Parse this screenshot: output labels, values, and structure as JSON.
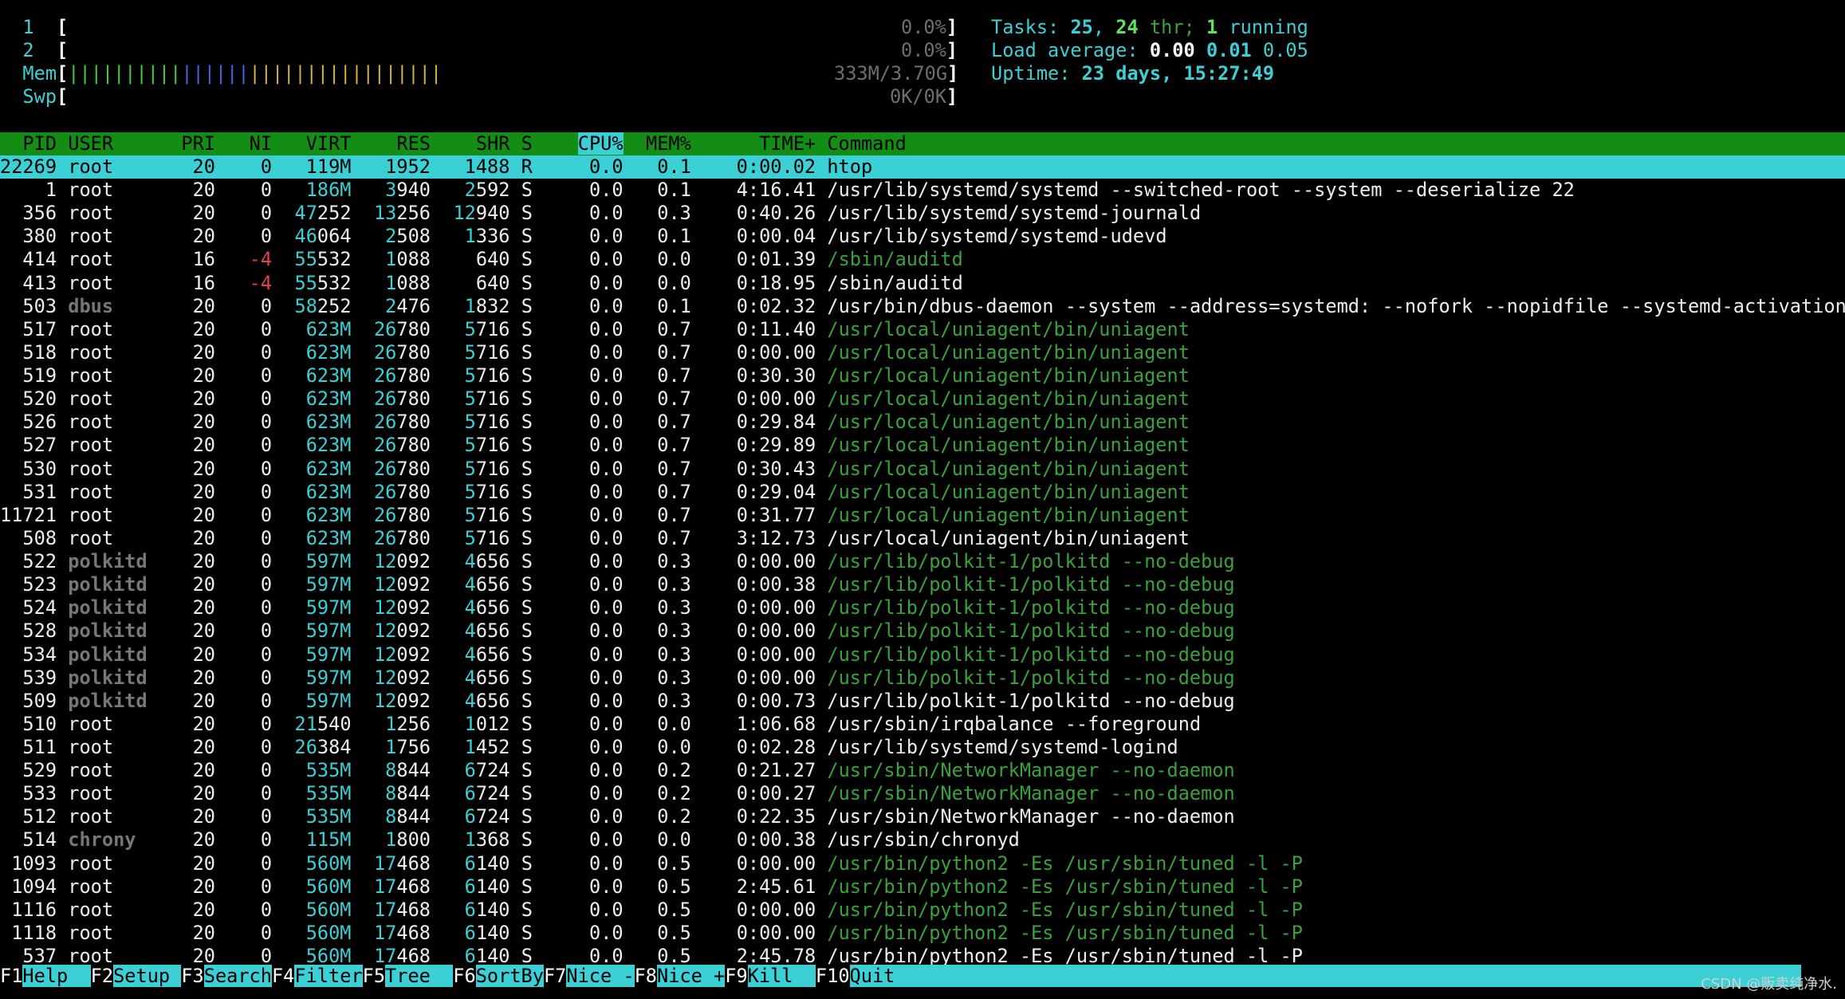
{
  "meters": {
    "cpu1": {
      "label": "1",
      "value": "0.0%"
    },
    "cpu2": {
      "label": "2",
      "value": "0.0%"
    },
    "mem": {
      "label": "Mem",
      "value": "333M/3.70G"
    },
    "swp": {
      "label": "Swp",
      "value": "0K/0K"
    }
  },
  "stats": {
    "tasks_label": "Tasks:",
    "tasks": "25",
    "threads": "24",
    "thr_label": "thr;",
    "running": "1",
    "running_label": "running",
    "load_label": "Load average:",
    "load1": "0.00",
    "load5": "0.01",
    "load15": "0.05",
    "uptime_label": "Uptime:",
    "uptime": "23 days, 15:27:49"
  },
  "columns": [
    "PID",
    "USER",
    "PRI",
    "NI",
    "VIRT",
    "RES",
    "SHR",
    "S",
    "CPU%",
    "MEM%",
    "TIME+",
    "Command"
  ],
  "sorted_column": "CPU%",
  "processes": [
    {
      "pid": "22269",
      "user": "root",
      "pri": "20",
      "ni": "0",
      "virt": "119M",
      "res": "1952",
      "shr": "1488",
      "s": "R",
      "cpu": "0.0",
      "mem": "0.1",
      "time": "0:00.02",
      "cmd": "htop",
      "selected": true
    },
    {
      "pid": "1",
      "user": "root",
      "pri": "20",
      "ni": "0",
      "virt": "186M",
      "res": "3940",
      "shr": "2592",
      "s": "S",
      "cpu": "0.0",
      "mem": "0.1",
      "time": "4:16.41",
      "cmd": "/usr/lib/systemd/systemd --switched-root --system --deserialize 22"
    },
    {
      "pid": "356",
      "user": "root",
      "pri": "20",
      "ni": "0",
      "virt": "47252",
      "res": "13256",
      "shr": "12940",
      "s": "S",
      "cpu": "0.0",
      "mem": "0.3",
      "time": "0:40.26",
      "cmd": "/usr/lib/systemd/systemd-journald"
    },
    {
      "pid": "380",
      "user": "root",
      "pri": "20",
      "ni": "0",
      "virt": "46064",
      "res": "2508",
      "shr": "1336",
      "s": "S",
      "cpu": "0.0",
      "mem": "0.1",
      "time": "0:00.04",
      "cmd": "/usr/lib/systemd/systemd-udevd"
    },
    {
      "pid": "414",
      "user": "root",
      "pri": "16",
      "ni": "-4",
      "virt": "55532",
      "res": "1088",
      "shr": "640",
      "s": "S",
      "cpu": "0.0",
      "mem": "0.0",
      "time": "0:01.39",
      "cmd": "/sbin/auditd",
      "thread": true
    },
    {
      "pid": "413",
      "user": "root",
      "pri": "16",
      "ni": "-4",
      "virt": "55532",
      "res": "1088",
      "shr": "640",
      "s": "S",
      "cpu": "0.0",
      "mem": "0.0",
      "time": "0:18.95",
      "cmd": "/sbin/auditd"
    },
    {
      "pid": "503",
      "user": "dbus",
      "pri": "20",
      "ni": "0",
      "virt": "58252",
      "res": "2476",
      "shr": "1832",
      "s": "S",
      "cpu": "0.0",
      "mem": "0.1",
      "time": "0:02.32",
      "cmd": "/usr/bin/dbus-daemon --system --address=systemd: --nofork --nopidfile --systemd-activation"
    },
    {
      "pid": "517",
      "user": "root",
      "pri": "20",
      "ni": "0",
      "virt": "623M",
      "res": "26780",
      "shr": "5716",
      "s": "S",
      "cpu": "0.0",
      "mem": "0.7",
      "time": "0:11.40",
      "cmd": "/usr/local/uniagent/bin/uniagent",
      "thread": true
    },
    {
      "pid": "518",
      "user": "root",
      "pri": "20",
      "ni": "0",
      "virt": "623M",
      "res": "26780",
      "shr": "5716",
      "s": "S",
      "cpu": "0.0",
      "mem": "0.7",
      "time": "0:00.00",
      "cmd": "/usr/local/uniagent/bin/uniagent",
      "thread": true
    },
    {
      "pid": "519",
      "user": "root",
      "pri": "20",
      "ni": "0",
      "virt": "623M",
      "res": "26780",
      "shr": "5716",
      "s": "S",
      "cpu": "0.0",
      "mem": "0.7",
      "time": "0:30.30",
      "cmd": "/usr/local/uniagent/bin/uniagent",
      "thread": true
    },
    {
      "pid": "520",
      "user": "root",
      "pri": "20",
      "ni": "0",
      "virt": "623M",
      "res": "26780",
      "shr": "5716",
      "s": "S",
      "cpu": "0.0",
      "mem": "0.7",
      "time": "0:00.00",
      "cmd": "/usr/local/uniagent/bin/uniagent",
      "thread": true
    },
    {
      "pid": "526",
      "user": "root",
      "pri": "20",
      "ni": "0",
      "virt": "623M",
      "res": "26780",
      "shr": "5716",
      "s": "S",
      "cpu": "0.0",
      "mem": "0.7",
      "time": "0:29.84",
      "cmd": "/usr/local/uniagent/bin/uniagent",
      "thread": true
    },
    {
      "pid": "527",
      "user": "root",
      "pri": "20",
      "ni": "0",
      "virt": "623M",
      "res": "26780",
      "shr": "5716",
      "s": "S",
      "cpu": "0.0",
      "mem": "0.7",
      "time": "0:29.89",
      "cmd": "/usr/local/uniagent/bin/uniagent",
      "thread": true
    },
    {
      "pid": "530",
      "user": "root",
      "pri": "20",
      "ni": "0",
      "virt": "623M",
      "res": "26780",
      "shr": "5716",
      "s": "S",
      "cpu": "0.0",
      "mem": "0.7",
      "time": "0:30.43",
      "cmd": "/usr/local/uniagent/bin/uniagent",
      "thread": true
    },
    {
      "pid": "531",
      "user": "root",
      "pri": "20",
      "ni": "0",
      "virt": "623M",
      "res": "26780",
      "shr": "5716",
      "s": "S",
      "cpu": "0.0",
      "mem": "0.7",
      "time": "0:29.04",
      "cmd": "/usr/local/uniagent/bin/uniagent",
      "thread": true
    },
    {
      "pid": "11721",
      "user": "root",
      "pri": "20",
      "ni": "0",
      "virt": "623M",
      "res": "26780",
      "shr": "5716",
      "s": "S",
      "cpu": "0.0",
      "mem": "0.7",
      "time": "0:31.77",
      "cmd": "/usr/local/uniagent/bin/uniagent",
      "thread": true
    },
    {
      "pid": "508",
      "user": "root",
      "pri": "20",
      "ni": "0",
      "virt": "623M",
      "res": "26780",
      "shr": "5716",
      "s": "S",
      "cpu": "0.0",
      "mem": "0.7",
      "time": "3:12.73",
      "cmd": "/usr/local/uniagent/bin/uniagent"
    },
    {
      "pid": "522",
      "user": "polkitd",
      "pri": "20",
      "ni": "0",
      "virt": "597M",
      "res": "12092",
      "shr": "4656",
      "s": "S",
      "cpu": "0.0",
      "mem": "0.3",
      "time": "0:00.00",
      "cmd": "/usr/lib/polkit-1/polkitd --no-debug",
      "thread": true
    },
    {
      "pid": "523",
      "user": "polkitd",
      "pri": "20",
      "ni": "0",
      "virt": "597M",
      "res": "12092",
      "shr": "4656",
      "s": "S",
      "cpu": "0.0",
      "mem": "0.3",
      "time": "0:00.38",
      "cmd": "/usr/lib/polkit-1/polkitd --no-debug",
      "thread": true
    },
    {
      "pid": "524",
      "user": "polkitd",
      "pri": "20",
      "ni": "0",
      "virt": "597M",
      "res": "12092",
      "shr": "4656",
      "s": "S",
      "cpu": "0.0",
      "mem": "0.3",
      "time": "0:00.00",
      "cmd": "/usr/lib/polkit-1/polkitd --no-debug",
      "thread": true
    },
    {
      "pid": "528",
      "user": "polkitd",
      "pri": "20",
      "ni": "0",
      "virt": "597M",
      "res": "12092",
      "shr": "4656",
      "s": "S",
      "cpu": "0.0",
      "mem": "0.3",
      "time": "0:00.00",
      "cmd": "/usr/lib/polkit-1/polkitd --no-debug",
      "thread": true
    },
    {
      "pid": "534",
      "user": "polkitd",
      "pri": "20",
      "ni": "0",
      "virt": "597M",
      "res": "12092",
      "shr": "4656",
      "s": "S",
      "cpu": "0.0",
      "mem": "0.3",
      "time": "0:00.00",
      "cmd": "/usr/lib/polkit-1/polkitd --no-debug",
      "thread": true
    },
    {
      "pid": "539",
      "user": "polkitd",
      "pri": "20",
      "ni": "0",
      "virt": "597M",
      "res": "12092",
      "shr": "4656",
      "s": "S",
      "cpu": "0.0",
      "mem": "0.3",
      "time": "0:00.00",
      "cmd": "/usr/lib/polkit-1/polkitd --no-debug",
      "thread": true
    },
    {
      "pid": "509",
      "user": "polkitd",
      "pri": "20",
      "ni": "0",
      "virt": "597M",
      "res": "12092",
      "shr": "4656",
      "s": "S",
      "cpu": "0.0",
      "mem": "0.3",
      "time": "0:00.73",
      "cmd": "/usr/lib/polkit-1/polkitd --no-debug"
    },
    {
      "pid": "510",
      "user": "root",
      "pri": "20",
      "ni": "0",
      "virt": "21540",
      "res": "1256",
      "shr": "1012",
      "s": "S",
      "cpu": "0.0",
      "mem": "0.0",
      "time": "1:06.68",
      "cmd": "/usr/sbin/irqbalance --foreground"
    },
    {
      "pid": "511",
      "user": "root",
      "pri": "20",
      "ni": "0",
      "virt": "26384",
      "res": "1756",
      "shr": "1452",
      "s": "S",
      "cpu": "0.0",
      "mem": "0.0",
      "time": "0:02.28",
      "cmd": "/usr/lib/systemd/systemd-logind"
    },
    {
      "pid": "529",
      "user": "root",
      "pri": "20",
      "ni": "0",
      "virt": "535M",
      "res": "8844",
      "shr": "6724",
      "s": "S",
      "cpu": "0.0",
      "mem": "0.2",
      "time": "0:21.27",
      "cmd": "/usr/sbin/NetworkManager --no-daemon",
      "thread": true
    },
    {
      "pid": "533",
      "user": "root",
      "pri": "20",
      "ni": "0",
      "virt": "535M",
      "res": "8844",
      "shr": "6724",
      "s": "S",
      "cpu": "0.0",
      "mem": "0.2",
      "time": "0:00.27",
      "cmd": "/usr/sbin/NetworkManager --no-daemon",
      "thread": true
    },
    {
      "pid": "512",
      "user": "root",
      "pri": "20",
      "ni": "0",
      "virt": "535M",
      "res": "8844",
      "shr": "6724",
      "s": "S",
      "cpu": "0.0",
      "mem": "0.2",
      "time": "0:22.35",
      "cmd": "/usr/sbin/NetworkManager --no-daemon"
    },
    {
      "pid": "514",
      "user": "chrony",
      "pri": "20",
      "ni": "0",
      "virt": "115M",
      "res": "1800",
      "shr": "1368",
      "s": "S",
      "cpu": "0.0",
      "mem": "0.0",
      "time": "0:00.38",
      "cmd": "/usr/sbin/chronyd"
    },
    {
      "pid": "1093",
      "user": "root",
      "pri": "20",
      "ni": "0",
      "virt": "560M",
      "res": "17468",
      "shr": "6140",
      "s": "S",
      "cpu": "0.0",
      "mem": "0.5",
      "time": "0:00.00",
      "cmd": "/usr/bin/python2 -Es /usr/sbin/tuned -l -P",
      "thread": true
    },
    {
      "pid": "1094",
      "user": "root",
      "pri": "20",
      "ni": "0",
      "virt": "560M",
      "res": "17468",
      "shr": "6140",
      "s": "S",
      "cpu": "0.0",
      "mem": "0.5",
      "time": "2:45.61",
      "cmd": "/usr/bin/python2 -Es /usr/sbin/tuned -l -P",
      "thread": true
    },
    {
      "pid": "1116",
      "user": "root",
      "pri": "20",
      "ni": "0",
      "virt": "560M",
      "res": "17468",
      "shr": "6140",
      "s": "S",
      "cpu": "0.0",
      "mem": "0.5",
      "time": "0:00.00",
      "cmd": "/usr/bin/python2 -Es /usr/sbin/tuned -l -P",
      "thread": true
    },
    {
      "pid": "1118",
      "user": "root",
      "pri": "20",
      "ni": "0",
      "virt": "560M",
      "res": "17468",
      "shr": "6140",
      "s": "S",
      "cpu": "0.0",
      "mem": "0.5",
      "time": "0:00.00",
      "cmd": "/usr/bin/python2 -Es /usr/sbin/tuned -l -P",
      "thread": true
    },
    {
      "pid": "537",
      "user": "root",
      "pri": "20",
      "ni": "0",
      "virt": "560M",
      "res": "17468",
      "shr": "6140",
      "s": "S",
      "cpu": "0.0",
      "mem": "0.5",
      "time": "2:45.78",
      "cmd": "/usr/bin/python2 -Es /usr/sbin/tuned -l -P"
    }
  ],
  "footer": [
    {
      "key": "F1",
      "label": "Help  "
    },
    {
      "key": "F2",
      "label": "Setup "
    },
    {
      "key": "F3",
      "label": "Search"
    },
    {
      "key": "F4",
      "label": "Filter"
    },
    {
      "key": "F5",
      "label": "Tree  "
    },
    {
      "key": "F6",
      "label": "SortBy"
    },
    {
      "key": "F7",
      "label": "Nice -"
    },
    {
      "key": "F8",
      "label": "Nice +"
    },
    {
      "key": "F9",
      "label": "Kill  "
    },
    {
      "key": "F10",
      "label": "Quit"
    }
  ],
  "watermark": "CSDN @贩卖纯净水.",
  "colors": {
    "header_bg": "#138d13",
    "selected_bg": "#3ad0d6",
    "accent_cyan": "#3ad0d6",
    "thread_green": "#3aa23a"
  }
}
